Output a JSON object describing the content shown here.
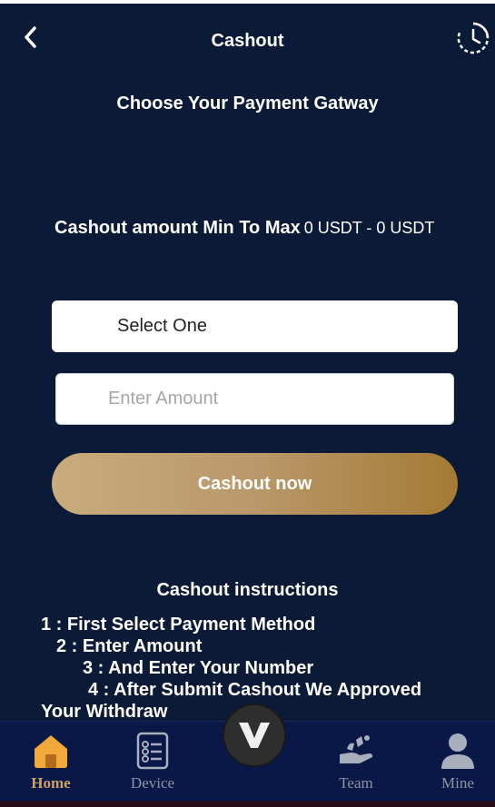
{
  "header": {
    "title": "Cashout",
    "back_icon": "chevron-left-icon",
    "history_icon": "clock-history-icon"
  },
  "gateway_heading": "Choose Your Payment Gatway",
  "range": {
    "label": "Cashout amount Min To Max",
    "value": "0 USDT - 0 USDT"
  },
  "form": {
    "select_value": "Select One",
    "amount_placeholder": "Enter Amount",
    "submit_label": "Cashout now"
  },
  "instructions": {
    "title": "Cashout instructions",
    "lines": [
      "1 : First Select Payment Method",
      "2 : Enter Amount",
      "3 : And Enter Your Number",
      "4 : After Submit Cashout We Approved",
      "Your Withdraw"
    ]
  },
  "nav": {
    "items": [
      {
        "label": "Home",
        "icon": "home-icon",
        "active": true
      },
      {
        "label": "Device",
        "icon": "device-list-icon",
        "active": false
      },
      {
        "label": "",
        "icon": "v-logo-icon",
        "active": false
      },
      {
        "label": "Team",
        "icon": "team-hand-icon",
        "active": false
      },
      {
        "label": "Mine",
        "icon": "user-icon",
        "active": false
      }
    ]
  },
  "colors": {
    "background": "#0b1a36",
    "nav_background": "#0a1848",
    "accent_gold": "#c9a266",
    "button_gradient_start": "#c9ac7c",
    "button_gradient_end": "#a57a34",
    "nav_inactive": "#8e94a6"
  }
}
